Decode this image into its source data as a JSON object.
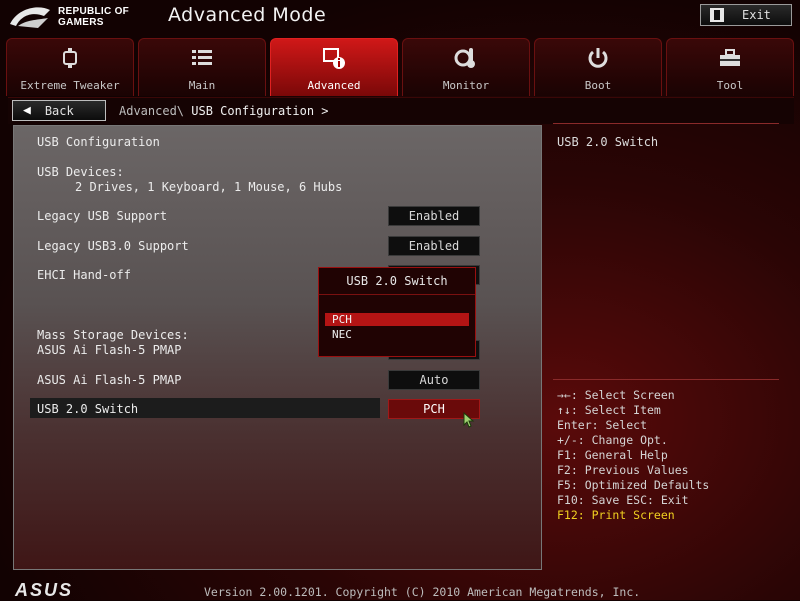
{
  "header": {
    "brand_line1": "REPUBLIC OF",
    "brand_line2": "GAMERS",
    "title": "Advanced Mode",
    "exit_label": "Exit"
  },
  "tabs": [
    {
      "label": "Extreme Tweaker",
      "icon": "tweaker-icon"
    },
    {
      "label": "Main",
      "icon": "list-icon"
    },
    {
      "label": "Advanced",
      "icon": "advanced-info-icon",
      "active": true
    },
    {
      "label": "Monitor",
      "icon": "thermometer-gear-icon"
    },
    {
      "label": "Boot",
      "icon": "power-icon"
    },
    {
      "label": "Tool",
      "icon": "toolbox-icon"
    }
  ],
  "breadcrumb": {
    "back_label": "Back",
    "parent": "Advanced\\",
    "current": "USB Configuration >"
  },
  "main": {
    "section_title": "USB Configuration",
    "usb_devices_label": "USB Devices:",
    "usb_devices_value": "2 Drives, 1 Keyboard, 1 Mouse, 6 Hubs",
    "legacy_usb_label": "Legacy USB Support",
    "legacy_usb_value": "Enabled",
    "legacy_usb3_label": "Legacy USB3.0 Support",
    "legacy_usb3_value": "Enabled",
    "ehci_label": "EHCI Hand-off",
    "mass_storage_label": "Mass Storage Devices:",
    "flash1_label": "ASUS Ai Flash-5 PMAP",
    "flash2_label": "ASUS Ai Flash-5 PMAP",
    "flash2_value": "Auto",
    "usb20_label": "USB 2.0 Switch",
    "usb20_value": "PCH"
  },
  "popup": {
    "title": "USB 2.0 Switch",
    "options": [
      "PCH",
      "NEC"
    ],
    "selected": "PCH"
  },
  "help": {
    "title": "USB 2.0 Switch",
    "keys": [
      "→←: Select Screen",
      "↑↓: Select Item",
      "Enter: Select",
      "+/-: Change Opt.",
      "F1: General Help",
      "F2: Previous Values",
      "F5: Optimized Defaults",
      "F10: Save  ESC: Exit",
      "F12: Print Screen"
    ]
  },
  "footer": {
    "brand": "ASUS",
    "version": "Version 2.00.1201. Copyright (C) 2010 American Megatrends, Inc."
  },
  "colors": {
    "accent_red": "#d01818",
    "highlight_yellow": "#f0d020"
  }
}
